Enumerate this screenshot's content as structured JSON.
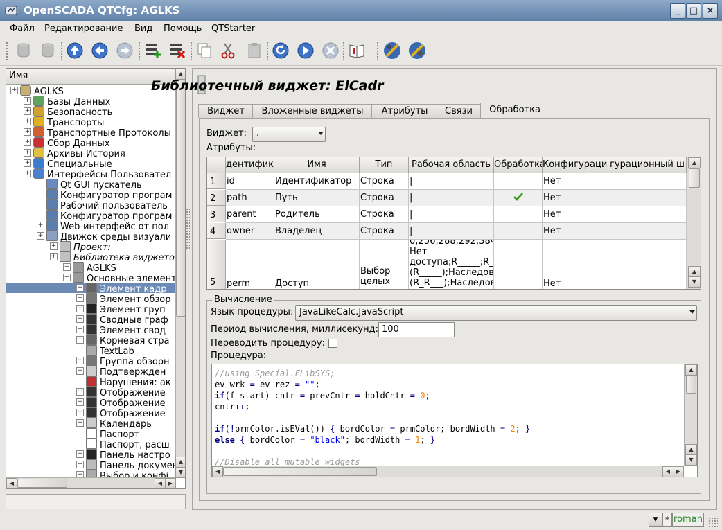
{
  "window": {
    "title": "OpenSCADA QTCfg: AGLKS"
  },
  "menu": [
    {
      "label": "Файл"
    },
    {
      "label": "Редактирование"
    },
    {
      "label": "Вид"
    },
    {
      "label": "Помощь"
    },
    {
      "label": "QTStarter"
    }
  ],
  "toolbar": {
    "icons": [
      "db-load-icon",
      "db-save-icon",
      "up-icon",
      "back-icon",
      "forward-icon",
      "add-item-icon",
      "delete-item-icon",
      "copy-icon",
      "cut-icon",
      "paste-icon",
      "refresh-icon",
      "start-icon",
      "stop-icon",
      "manual-icon",
      "user-connect-icon",
      "system-config-icon"
    ]
  },
  "tree": {
    "header": "Имя",
    "items": [
      {
        "label": "AGLKS",
        "italic": false
      },
      {
        "label": "Базы Данных",
        "italic": false
      },
      {
        "label": "Безопасность",
        "italic": false
      },
      {
        "label": "Транспорты",
        "italic": false
      },
      {
        "label": "Транспортные Протоколы",
        "italic": false
      },
      {
        "label": "Сбор Данных",
        "italic": false
      },
      {
        "label": "Архивы-История",
        "italic": false
      },
      {
        "label": "Специальные",
        "italic": false
      },
      {
        "label": "Интерфейсы Пользовател",
        "italic": false
      },
      {
        "label": "Qt GUI пускатель",
        "italic": false
      },
      {
        "label": "Конфигуратор програм",
        "italic": false
      },
      {
        "label": "Рабочий пользователь",
        "italic": false
      },
      {
        "label": "Конфигуратор програм",
        "italic": false
      },
      {
        "label": "Web-интерфейс от пол",
        "italic": false
      },
      {
        "label": "Движок среды визуали",
        "italic": false
      },
      {
        "label": "Проект:",
        "italic": true
      },
      {
        "label": "Библиотека виджетов:",
        "italic": true
      },
      {
        "label": "AGLKS",
        "italic": false
      },
      {
        "label": "Основные элементы",
        "italic": false
      },
      {
        "label": "Элемент кадр",
        "italic": false
      },
      {
        "label": "Элемент обзор",
        "italic": false
      },
      {
        "label": "Элемент груп",
        "italic": false
      },
      {
        "label": "Сводные граф",
        "italic": false
      },
      {
        "label": "Элемент свод",
        "italic": false
      },
      {
        "label": "Корневая стра",
        "italic": false
      },
      {
        "label": "TextLab",
        "italic": false
      },
      {
        "label": "Группа обзорн",
        "italic": false
      },
      {
        "label": "Подтвержден",
        "italic": false
      },
      {
        "label": "Нарушения: ак",
        "italic": false
      },
      {
        "label": "Отображение",
        "italic": false
      },
      {
        "label": "Отображение",
        "italic": false
      },
      {
        "label": "Отображение",
        "italic": false
      },
      {
        "label": "Календарь",
        "italic": false
      },
      {
        "label": "Паспорт",
        "italic": false
      },
      {
        "label": "Паспорт, расш",
        "italic": false
      },
      {
        "label": "Панель настро",
        "italic": false
      },
      {
        "label": "Панель докумен",
        "italic": false
      },
      {
        "label": "Выбор и конфі",
        "italic": false
      }
    ]
  },
  "widget": {
    "title": "Библиотечный виджет: ElCadr",
    "tabs": [
      "Виджет",
      "Вложенные виджеты",
      "Атрибуты",
      "Связи",
      "Обработка"
    ],
    "active_tab": "Обработка",
    "widget_label": "Виджет:",
    "widget_value": ".",
    "attrs_label": "Атрибуты:",
    "columns": [
      "дентифика",
      "Имя",
      "Тип",
      "Рабочая область",
      "Обработка",
      "Конфигурация",
      "гурационный ш"
    ],
    "rows": [
      {
        "n": "1",
        "id": "id",
        "name": "Идентификатор",
        "type": "Строка",
        "work": "|",
        "proc": false,
        "conf": "Нет",
        "tmpl": ""
      },
      {
        "n": "2",
        "id": "path",
        "name": "Путь",
        "type": "Строка",
        "work": "|",
        "proc": true,
        "conf": "Нет",
        "tmpl": ""
      },
      {
        "n": "3",
        "id": "parent",
        "name": "Родитель",
        "type": "Строка",
        "work": "|",
        "proc": false,
        "conf": "Нет",
        "tmpl": ""
      },
      {
        "n": "4",
        "id": "owner",
        "name": "Владелец",
        "type": "Строка",
        "work": "|",
        "proc": false,
        "conf": "Нет",
        "tmpl": ""
      },
      {
        "n": "5",
        "id": "perm",
        "name": "Доступ",
        "type1": "Выбор",
        "type2": "целых",
        "work_lines": [
          "0;256;288;292;384;",
          "Нет",
          "доступа;R_____;R_",
          "(R_____);Наследов",
          "(R_R___);Наследов"
        ],
        "proc": false,
        "conf": "Нет",
        "tmpl": ""
      }
    ],
    "calc": {
      "legend": "Вычисление",
      "lang_label": "Язык процедуры:",
      "lang_value": "JavaLikeCalc.JavaScript",
      "period_label": "Период вычисления, миллисекунд:",
      "period_value": "100",
      "translate_label": "Переводить процедуру:",
      "proc_label": "Процедура:"
    }
  },
  "status": {
    "user": "roman"
  },
  "colors": {
    "accent": "#6b8ab5",
    "check": "#3a9a1a",
    "user_text": "#2a8a2a"
  }
}
